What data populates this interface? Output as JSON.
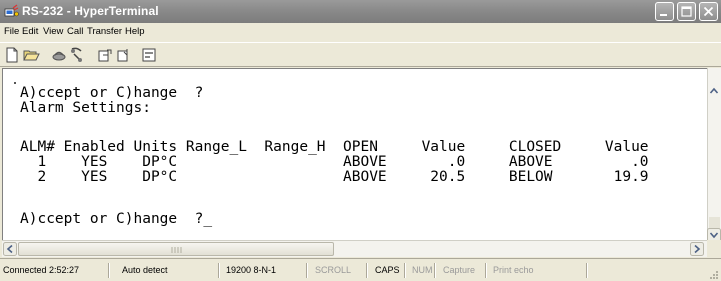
{
  "window": {
    "title": "RS-232 - HyperTerminal",
    "icon": "hyperterminal-icon"
  },
  "titlebar_buttons": [
    "minimize-icon",
    "maximize-icon",
    "close-icon"
  ],
  "menu": {
    "items": [
      {
        "label": "File"
      },
      {
        "label": "Edit"
      },
      {
        "label": "View"
      },
      {
        "label": "Call"
      },
      {
        "label": "Transfer"
      },
      {
        "label": "Help"
      }
    ]
  },
  "toolbar": {
    "tools": [
      "new-icon",
      "open-icon",
      "disconnect-icon",
      "call-icon",
      "send-icon",
      "receive-icon",
      "properties-icon"
    ]
  },
  "terminal": {
    "lines": [
      "A)ccept or C)hange  ?",
      "Alarm Settings:",
      "",
      "ALM# Enabled Units Range_L  Range_H  OPEN     Value     CLOSED     Value",
      "  1    YES    DP°C                   ABOVE       .0     ABOVE         .0",
      "  2    YES    DP°C                   ABOVE     20.5     BELOW       19.9",
      "",
      "A)ccept or C)hange  ?_"
    ]
  },
  "statusbar": {
    "connected": "Connected 2:52:27",
    "detect": "Auto detect",
    "settings": "19200 8-N-1",
    "scroll": "SCROLL",
    "caps": "CAPS",
    "num": "NUM",
    "capture": "Capture",
    "print_echo": "Print echo"
  }
}
